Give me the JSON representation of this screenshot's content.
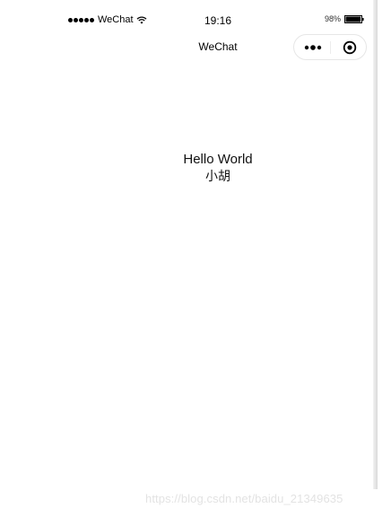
{
  "status_bar": {
    "carrier": "WeChat",
    "time": "19:16",
    "battery": "98%",
    "battery_level": 0.98
  },
  "nav": {
    "title": "WeChat",
    "more_icon": "more-dots-icon",
    "close_icon": "target-close-icon"
  },
  "content": {
    "line1": "Hello World",
    "line2": "小胡"
  },
  "watermark": "https://blog.csdn.net/baidu_21349635"
}
